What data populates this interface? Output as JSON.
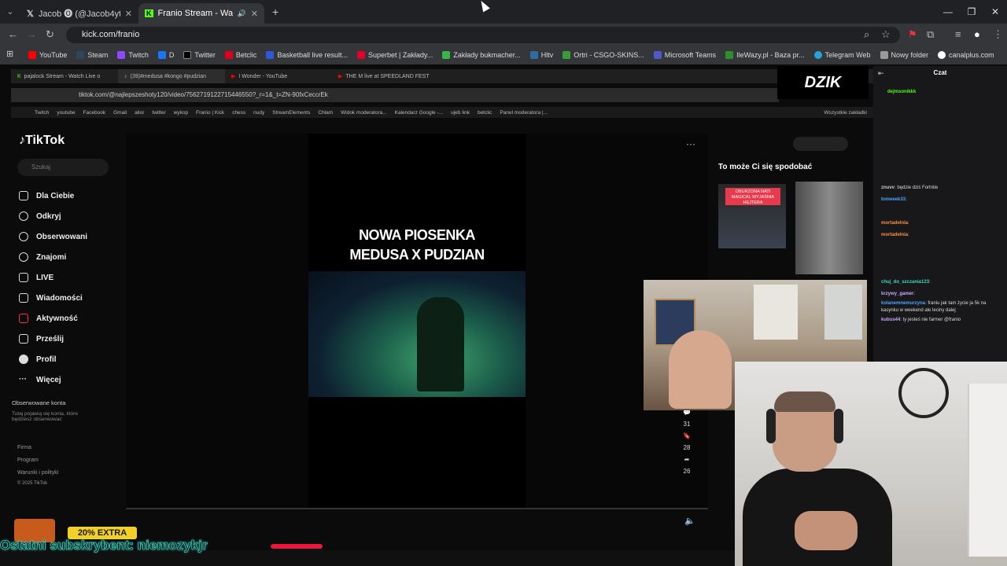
{
  "browser": {
    "tabs": [
      {
        "label": "Jacob 🅞 (@Jacob4yt) / X",
        "active": false
      },
      {
        "label": "Franio Stream - Watch Live",
        "active": true
      }
    ],
    "url": "kick.com/franio",
    "bookmarks": [
      "YouTube",
      "Steam",
      "Twitch",
      "D",
      "Twitter",
      "Betclic",
      "Basketball live result...",
      "Superbet | Zakłady...",
      "Zakłady bukmacher...",
      "Hltv",
      "Ortri - CSGO-SKINS...",
      "Microsoft Teams",
      "IleWazy.pl - Baza pr...",
      "Telegram Web",
      "Nowy folder",
      "canalplus.com"
    ]
  },
  "inner_browser": {
    "tabs": [
      "pajalock Stream - Watch Live o",
      "(39)#medusa #kongo #pudzian",
      "I Wonder - YouTube",
      "THE M live at SPEEDLAND FEST"
    ],
    "url": "tiktok.com/@najlepszeshoty120/video/7562719122715446550?_r=1&_t=ZN-90fxCeccrEk",
    "bookmarks": [
      "Twitch",
      "youtube",
      "Facebook",
      "Gmail",
      "alior",
      "twitter",
      "wykop",
      "Franio | Kick",
      "chess",
      "nudy",
      "StreamElements",
      "Chłam",
      "Widok moderatora...",
      "Kalendarz Google -...",
      "ujeb link",
      "betclic",
      "Panel moderatora |..."
    ],
    "bookmarks_right": "Wszystkie zakładki"
  },
  "tiktok": {
    "logo": "TikTok",
    "search_placeholder": "Szukaj",
    "nav": [
      "Dla Ciebie",
      "Odkryj",
      "Obserwowani",
      "Znajomi",
      "LIVE",
      "Wiadomości",
      "Aktywność",
      "Prześlij",
      "Profil",
      "Więcej"
    ],
    "followed_title": "Obserwowane konta",
    "followed_text": "Tutaj pojawią się konta, które będziesz obserwować",
    "footer": [
      "Firma",
      "Program",
      "Warunki i polityki",
      "© 2025 TikTok"
    ],
    "video_title_line1": "NOWA PIOSENKA",
    "video_title_line2": "MEDUSA X PUDZIAN",
    "action_counts": [
      "31",
      "28",
      "26"
    ],
    "recommend_title": "To może Ci się spodobać",
    "thumb_badge": "OBURZONA NATI MAGICAL WYJAŚNIA HEJTERA"
  },
  "overlay": {
    "brand": "DZIK",
    "chat_title": "Czat",
    "chat_messages": [
      {
        "user": "dejmsonikkk",
        "text": ""
      },
      {
        "user": "znuvv",
        "text": "będzie dziś Fortnite"
      },
      {
        "user": "tomeeek33",
        "text": ""
      },
      {
        "user": "mortadelnia",
        "text": ""
      },
      {
        "user": "mortadelnia",
        "text": ""
      },
      {
        "user": "chuj_do_szczania123",
        "text": ""
      },
      {
        "user": "krzywy_gamer",
        "text": ""
      },
      {
        "user": "kolanemnemurzyna",
        "text": "franiu jak tam życie ja 5k na kasynku w weekend ale leciny dalej"
      },
      {
        "user": "kubus44",
        "text": "ty jesteś nie farmer @franio"
      }
    ],
    "promo": "20% EXTRA",
    "last_sub": "Ostatni subskrybent: niemozykjr"
  }
}
